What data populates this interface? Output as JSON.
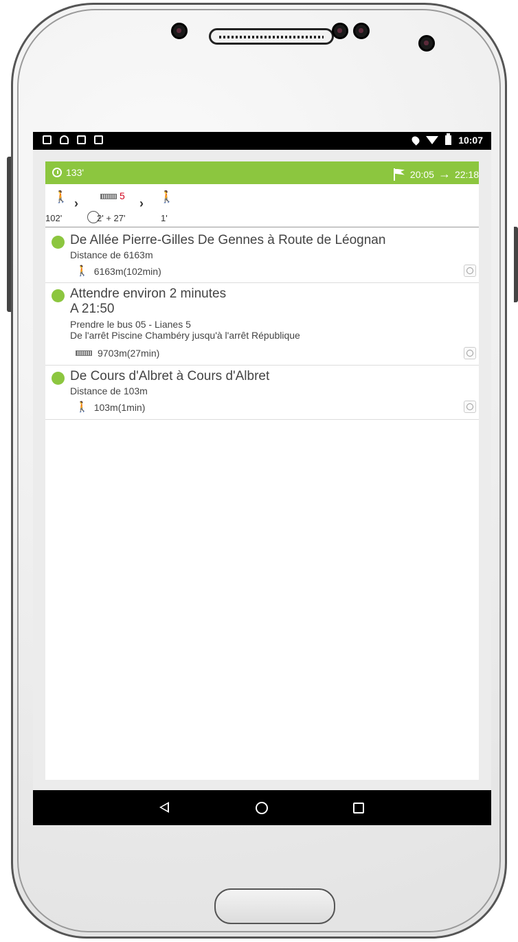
{
  "status_bar": {
    "time": "10:07"
  },
  "header": {
    "duration": "133'",
    "depart_time": "20:05",
    "arrow": "→",
    "arrive_time": "22:18",
    "accent_color": "#8cc63f"
  },
  "summary": {
    "walk1_time": "102'",
    "bus_line": "5",
    "bus_line_color": "#d0021b",
    "bus_time": "2' + 27'",
    "walk2_time": "1'",
    "chevron": "›"
  },
  "steps": [
    {
      "title": "De Allée Pierre-Gilles De Gennes à Route de Léognan",
      "subtitle": "Distance de 6163m",
      "detail": "6163m(102min)",
      "mode": "walk"
    },
    {
      "title": "Attendre environ 2 minutes",
      "time": "A 21:50",
      "line1": "Prendre le bus 05 - Lianes 5",
      "line2": "De l'arrêt Piscine Chambéry jusqu'à l'arrêt République",
      "detail": "9703m(27min)",
      "mode": "bus"
    },
    {
      "title": "De Cours d'Albret à Cours d'Albret",
      "subtitle": "Distance de 103m",
      "detail": "103m(1min)",
      "mode": "walk"
    }
  ],
  "icons": {
    "walk": "walk-icon",
    "bus": "bus-icon",
    "locate": "locate-icon",
    "clock": "clock-icon",
    "flag": "flag-icon"
  }
}
